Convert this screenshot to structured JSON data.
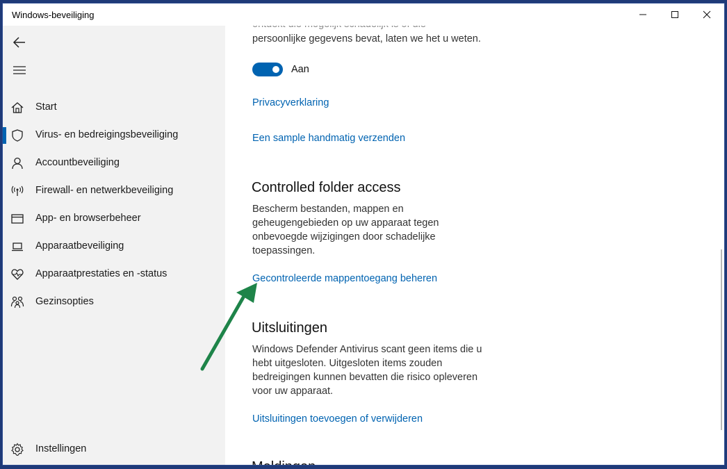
{
  "window": {
    "title": "Windows-beveiliging"
  },
  "sidebar": {
    "items": [
      {
        "label": "Start",
        "icon": "home-icon"
      },
      {
        "label": "Virus- en bedreigingsbeveiliging",
        "icon": "shield-icon",
        "active": true
      },
      {
        "label": "Accountbeveiliging",
        "icon": "person-icon"
      },
      {
        "label": "Firewall- en netwerkbeveiliging",
        "icon": "wifi-signal-icon"
      },
      {
        "label": "App- en browserbeheer",
        "icon": "browser-window-icon"
      },
      {
        "label": "Apparaatbeveiliging",
        "icon": "laptop-icon"
      },
      {
        "label": "Apparaatprestaties en -status",
        "icon": "heart-pulse-icon"
      },
      {
        "label": "Gezinsopties",
        "icon": "family-icon"
      }
    ],
    "settings_label": "Instellingen"
  },
  "content": {
    "top_text_partial": "persoonlijke gegevens bevat, laten we het u weten.",
    "toggle": {
      "label": "Aan",
      "on": true
    },
    "privacy_link": "Privacyverklaring",
    "sample_link": "Een sample handmatig verzenden",
    "cfa": {
      "title": "Controlled folder access",
      "desc_lines": [
        "Bescherm bestanden, mappen en",
        "geheugengebieden op uw apparaat tegen",
        "onbevoegde wijzigingen door schadelijke",
        "toepassingen."
      ],
      "link": "Gecontroleerde mappentoegang beheren"
    },
    "exclusions": {
      "title": "Uitsluitingen",
      "desc_lines": [
        "Windows Defender Antivirus scant geen items die u",
        "hebt uitgesloten. Uitgesloten items zouden",
        "bedreigingen kunnen bevatten die risico opleveren",
        "voor uw apparaat."
      ],
      "link": "Uitsluitingen toevoegen of verwijderen"
    },
    "notifications_title_partial": "Meldingen"
  },
  "colors": {
    "accent": "#0063b1",
    "annotation_arrow": "#1e8449",
    "sidebar_bg": "#f2f2f2"
  }
}
